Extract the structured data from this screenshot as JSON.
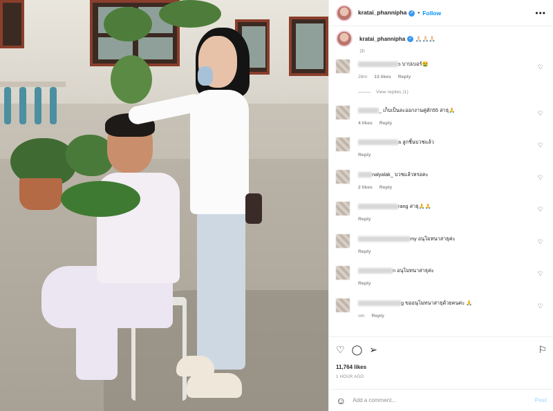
{
  "post": {
    "username": "kratai_phannipha",
    "follow_label": "Follow",
    "dot": "•",
    "more_icon": "more-horizontal-icon",
    "caption": "🙏🏻🙏🏻🙏🏻",
    "caption_time": "1h"
  },
  "comments": [
    {
      "text": "s บาปเบอร์🤮",
      "time": "28m",
      "likes": "13 likes",
      "reply": "Reply",
      "view_replies": "View replies (1)"
    },
    {
      "text": "_ เก็บเป็นละออกงานคู่ตัก55 สาธุ🙏",
      "time": "",
      "likes": "4 likes",
      "reply": "Reply"
    },
    {
      "text": "a ลูกชิ้นบวชแล้ว",
      "time": "",
      "likes": "",
      "reply": "Reply"
    },
    {
      "text": "nalyalak_ บวชแล้วหรอคะ",
      "time": "",
      "likes": "2 likes",
      "reply": "Reply"
    },
    {
      "text": "rang สาธุ🙏🙏",
      "time": "",
      "likes": "",
      "reply": "Reply"
    },
    {
      "text": "my อนุโมทนาสาธุค่ะ",
      "time": "",
      "likes": "",
      "reply": "Reply"
    },
    {
      "text": "n อนุโมทนาสาธุค่ะ",
      "time": "",
      "likes": "",
      "reply": "Reply"
    },
    {
      "text": "g ขออนุโมทนาสาธุด้วยคนค่ะ 🙏",
      "time": "om",
      "likes": "",
      "reply": "Reply"
    }
  ],
  "actions": {
    "likes": "11,764 likes",
    "ago": "1 HOUR AGO"
  },
  "composer": {
    "placeholder": "Add a comment...",
    "post_label": "Post"
  }
}
